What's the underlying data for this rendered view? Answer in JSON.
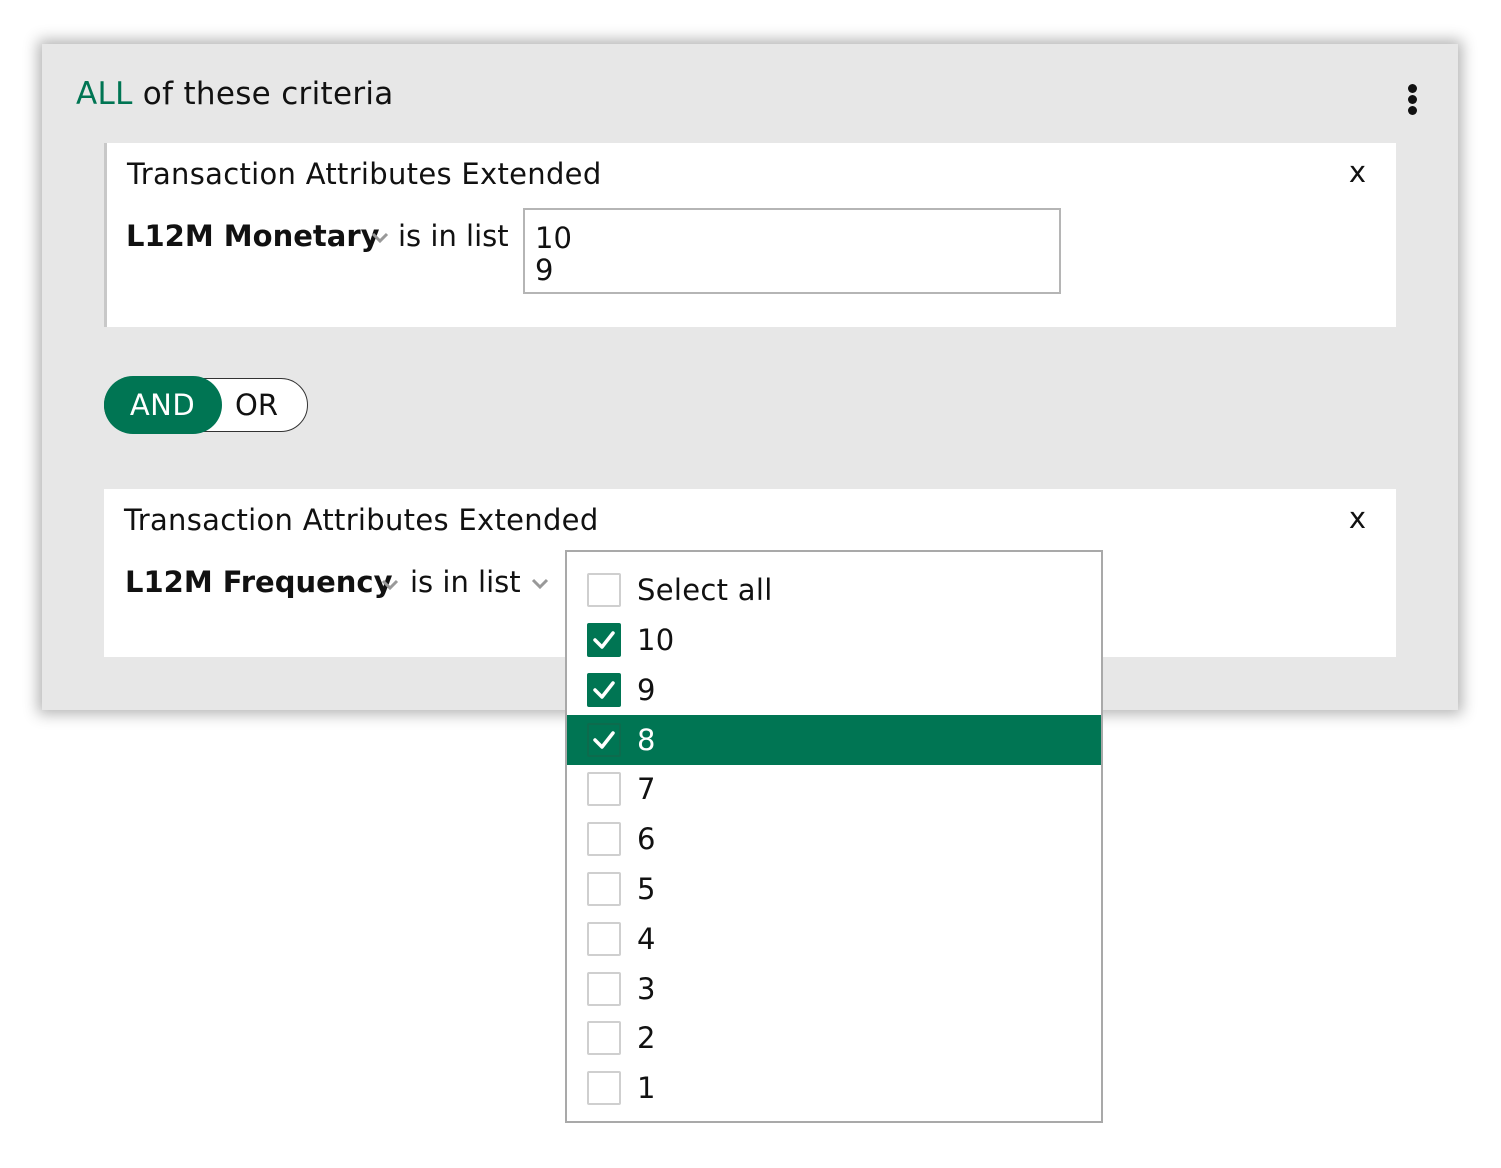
{
  "criteria": {
    "quantifier": "ALL",
    "title_rest": " of these criteria"
  },
  "card1": {
    "title": "Transaction Attributes Extended",
    "close_label": "x",
    "field": "L12M Monetary",
    "operator": "is in list",
    "values": [
      "10",
      "9"
    ]
  },
  "logic_toggle": {
    "and_label": "AND",
    "or_label": "OR",
    "selected": "AND"
  },
  "card2": {
    "title": "Transaction Attributes Extended",
    "close_label": "x",
    "field": "L12M Frequency",
    "operator": "is in list"
  },
  "dropdown": {
    "select_all_label": "Select all",
    "options": [
      {
        "label": "10",
        "checked": true,
        "highlighted": false
      },
      {
        "label": "9",
        "checked": true,
        "highlighted": false
      },
      {
        "label": "8",
        "checked": true,
        "highlighted": true
      },
      {
        "label": "7",
        "checked": false,
        "highlighted": false
      },
      {
        "label": "6",
        "checked": false,
        "highlighted": false
      },
      {
        "label": "5",
        "checked": false,
        "highlighted": false
      },
      {
        "label": "4",
        "checked": false,
        "highlighted": false
      },
      {
        "label": "3",
        "checked": false,
        "highlighted": false
      },
      {
        "label": "2",
        "checked": false,
        "highlighted": false
      },
      {
        "label": "1",
        "checked": false,
        "highlighted": false
      }
    ]
  },
  "colors": {
    "accent": "#007553",
    "panel_bg": "#e7e7e7",
    "card_bg": "#ffffff"
  },
  "icons": {
    "menu": "kebab-menu-icon",
    "dropdown": "chevron-down-icon",
    "check": "checkmark-icon"
  }
}
